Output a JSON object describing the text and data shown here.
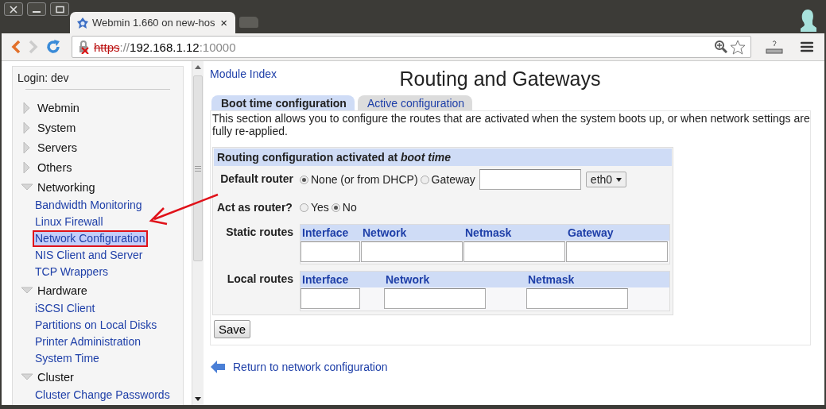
{
  "window": {
    "tab_title": "Webmin 1.660 on new-hos",
    "tab_close": "×",
    "url": {
      "scheme": "https",
      "separator": "://",
      "host": "192.168.1.12",
      "port": ":10000"
    }
  },
  "sidebar": {
    "login": "Login: dev",
    "categories": [
      {
        "label": "Webmin",
        "expanded": false
      },
      {
        "label": "System",
        "expanded": false
      },
      {
        "label": "Servers",
        "expanded": false
      },
      {
        "label": "Others",
        "expanded": false
      },
      {
        "label": "Networking",
        "expanded": true,
        "children": [
          {
            "label": "Bandwidth Monitoring",
            "selected": false
          },
          {
            "label": "Linux Firewall",
            "selected": false
          },
          {
            "label": "Network Configuration",
            "selected": true
          },
          {
            "label": "NIS Client and Server",
            "selected": false
          },
          {
            "label": "TCP Wrappers",
            "selected": false
          }
        ]
      },
      {
        "label": "Hardware",
        "expanded": true,
        "children": [
          {
            "label": "iSCSI Client",
            "selected": false
          },
          {
            "label": "Partitions on Local Disks",
            "selected": false
          },
          {
            "label": "Printer Administration",
            "selected": false
          },
          {
            "label": "System Time",
            "selected": false
          }
        ]
      },
      {
        "label": "Cluster",
        "expanded": true,
        "children": [
          {
            "label": "Cluster Change Passwords",
            "selected": false
          }
        ]
      }
    ]
  },
  "main": {
    "module_index": "Module Index",
    "title": "Routing and Gateways",
    "tabs": [
      {
        "label": "Boot time configuration",
        "selected": true
      },
      {
        "label": "Active configuration",
        "selected": false
      }
    ],
    "description": "This section allows you to configure the routes that are activated when the system boots up, or when network settings are fully re-applied.",
    "section_title": "Routing configuration activated at *boot time*",
    "default_router": {
      "label": "Default router",
      "options": [
        {
          "label": "None (or from DHCP)",
          "selected": true
        },
        {
          "label": "Gateway",
          "selected": false
        }
      ],
      "interface": "eth0"
    },
    "act_as_router": {
      "label": "Act as router?",
      "options": [
        {
          "label": "Yes",
          "selected": false
        },
        {
          "label": "No",
          "selected": true
        }
      ]
    },
    "static_routes": {
      "label": "Static routes",
      "columns": [
        "Interface",
        "Network",
        "Netmask",
        "Gateway"
      ]
    },
    "local_routes": {
      "label": "Local routes",
      "columns": [
        "Interface",
        "Network",
        "Netmask"
      ]
    },
    "save": "Save",
    "return_link": "Return to network configuration"
  }
}
